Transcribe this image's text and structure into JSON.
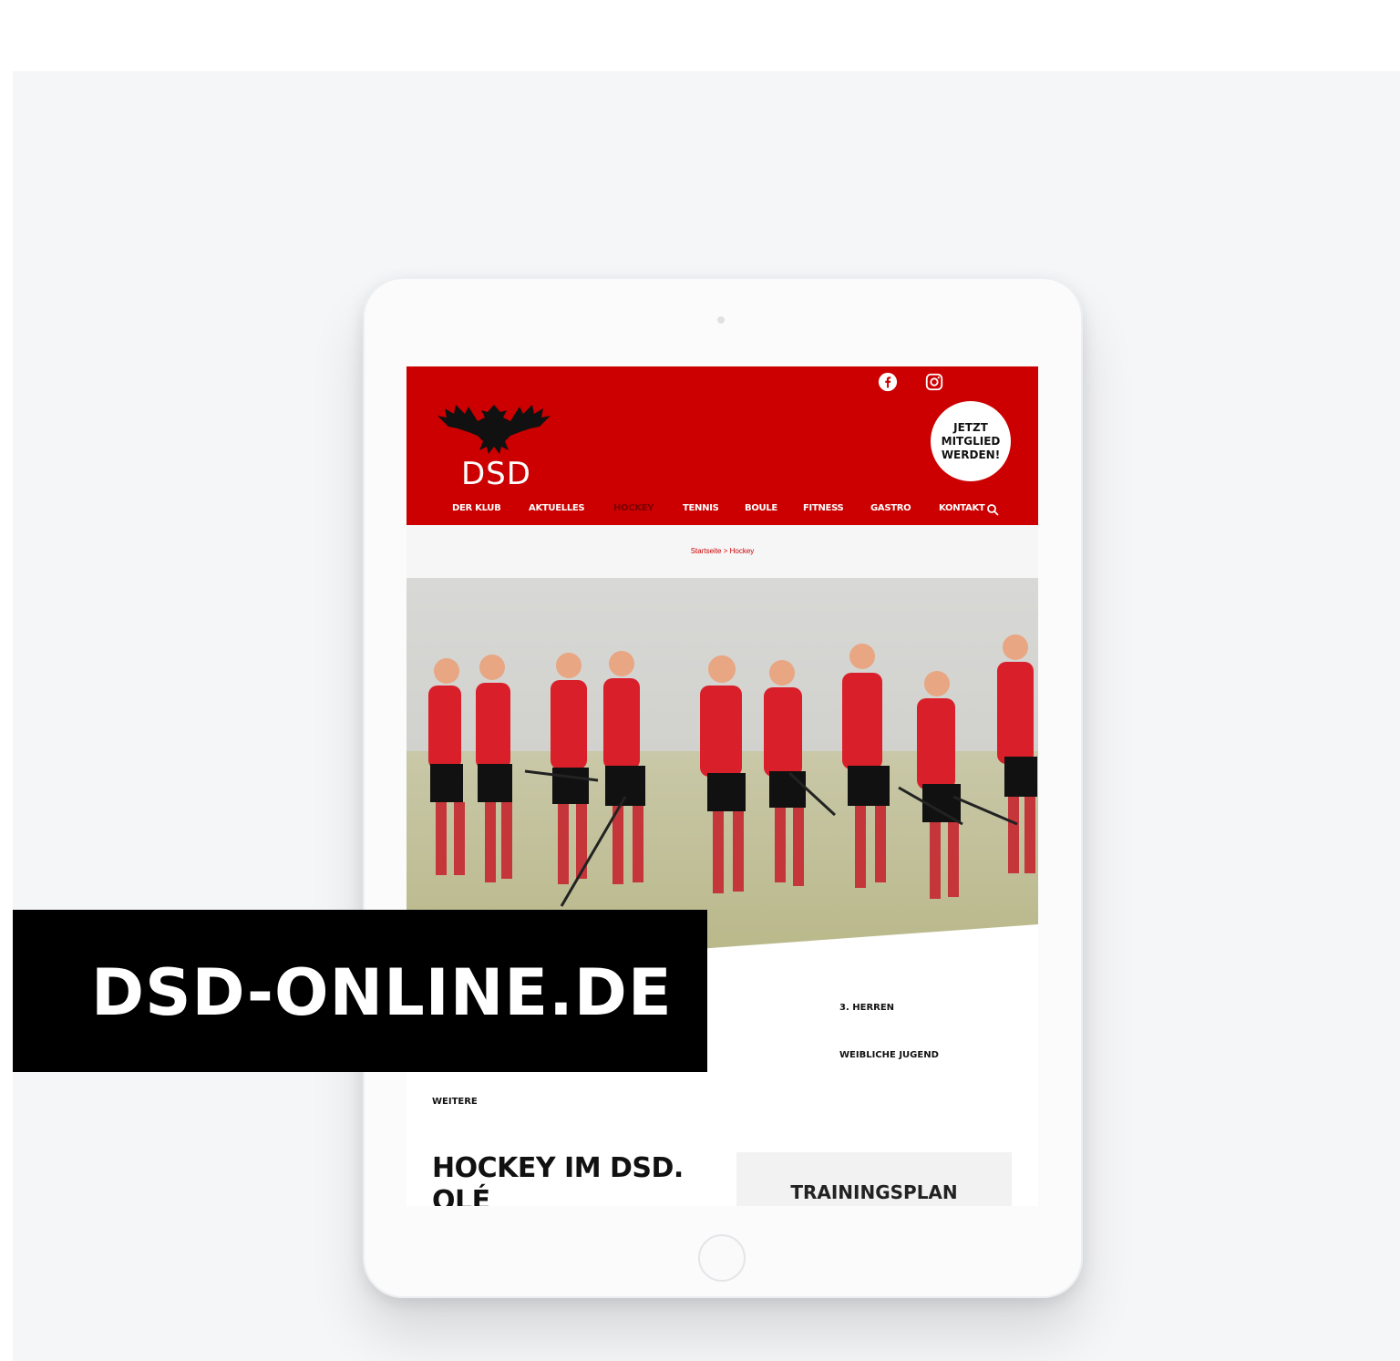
{
  "header": {
    "logo_text": "DSD",
    "member_button": "JETZT\nMITGLIED\nWERDEN!",
    "nav": [
      {
        "label": "DER KLUB"
      },
      {
        "label": "AKTUELLES"
      },
      {
        "label": "HOCKEY",
        "active": true
      },
      {
        "label": "TENNIS"
      },
      {
        "label": "BOULE"
      },
      {
        "label": "FITNESS"
      },
      {
        "label": "GASTRO"
      },
      {
        "label": "KONTAKT"
      }
    ],
    "social_icons": [
      "facebook-icon",
      "instagram-icon"
    ]
  },
  "breadcrumb": "Startseite > Hockey",
  "teams": {
    "herren3": "3. HERREN",
    "weibliche_jugend": "WEIBLICHE JUGEND",
    "weitere": "WEITERE"
  },
  "content": {
    "heading": "HOCKEY IM DSD. OLÉ",
    "training_title": "TRAININGSPLAN"
  },
  "overlay": {
    "domain": "DSD-ONLINE.DE"
  },
  "colors": {
    "brand_red": "#cc0000",
    "active_nav": "#7a0000",
    "overlay_bg": "#000000"
  }
}
